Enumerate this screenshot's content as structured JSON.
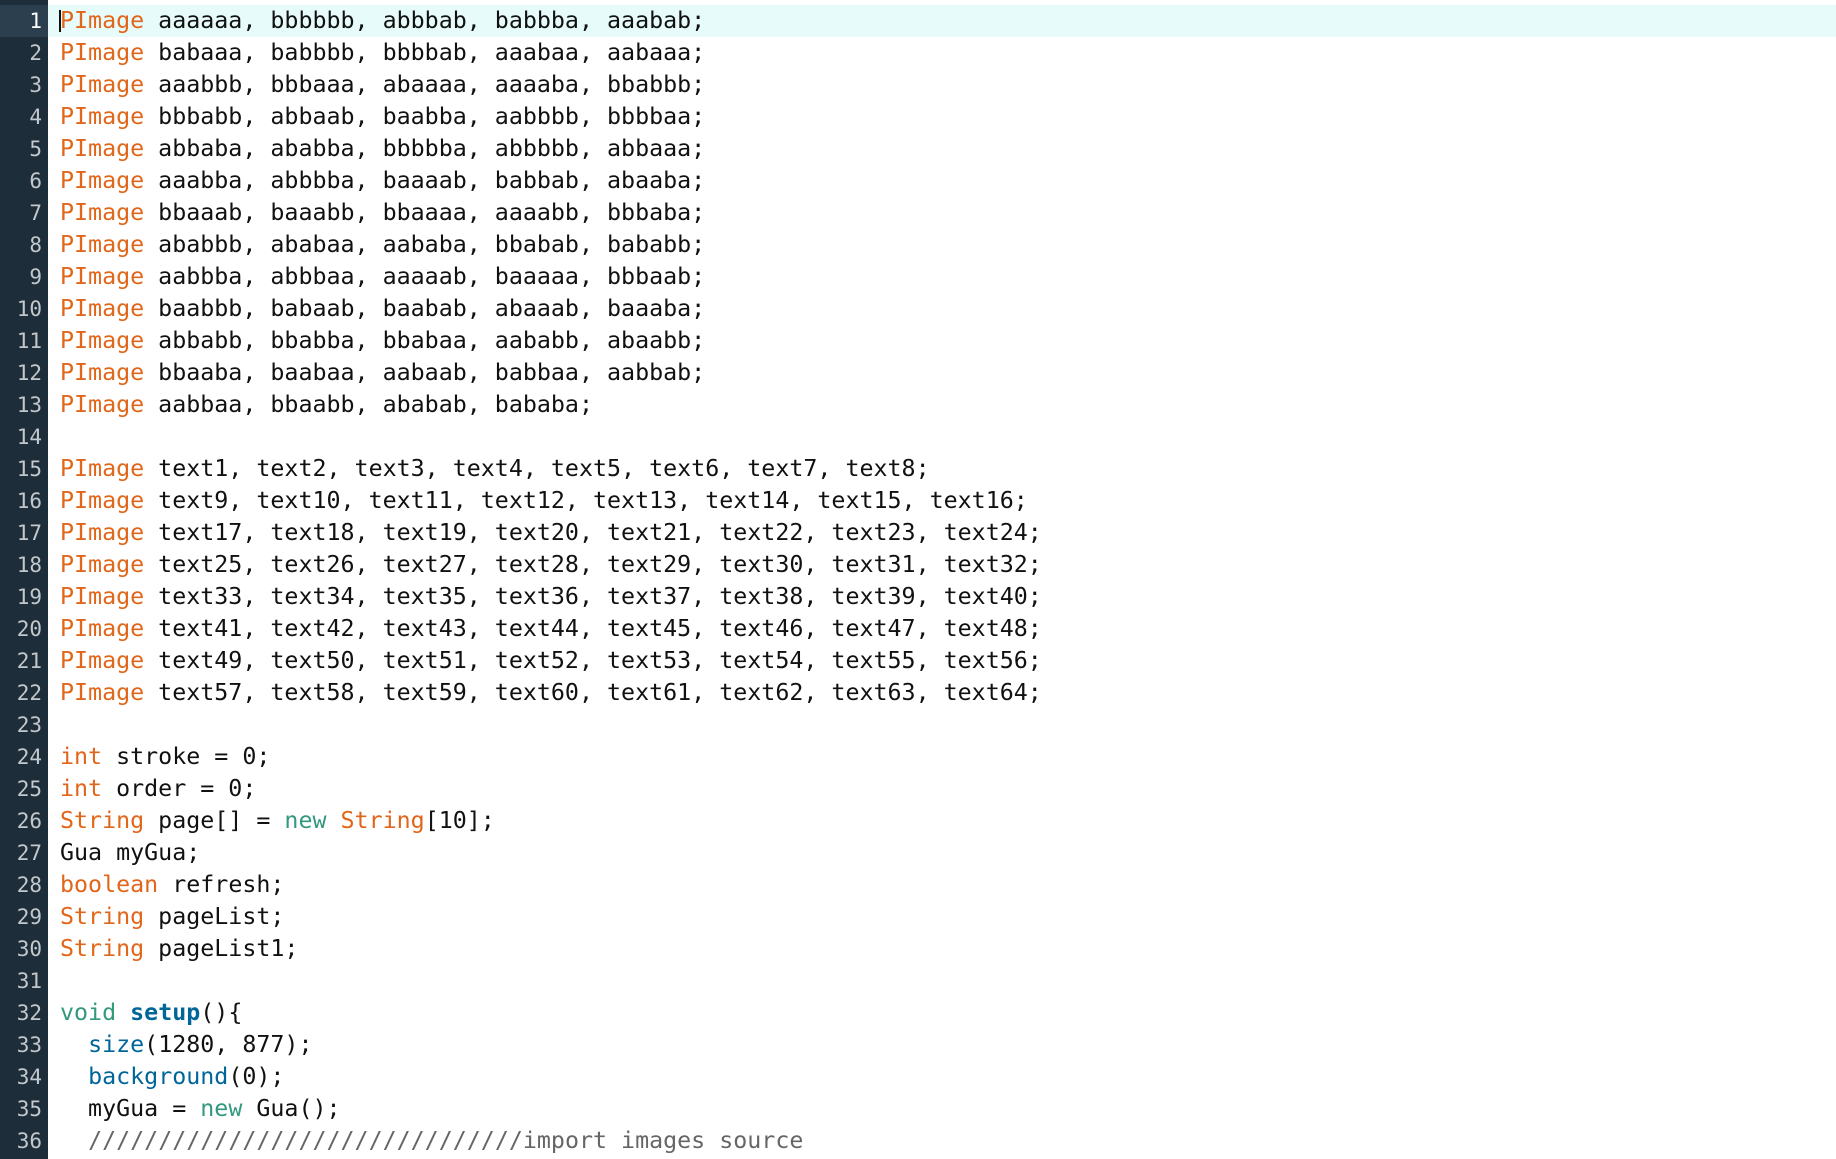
{
  "editor": {
    "current_line": 1,
    "lines": [
      {
        "num": "1",
        "tokens": [
          {
            "t": "type",
            "v": "PImage"
          },
          {
            "t": "plain",
            "v": " aaaaaa, bbbbbb, abbbab, babbba, aaabab;"
          }
        ]
      },
      {
        "num": "2",
        "tokens": [
          {
            "t": "type",
            "v": "PImage"
          },
          {
            "t": "plain",
            "v": " babaaa, babbbb, bbbbab, aaabaa, aabaaa;"
          }
        ]
      },
      {
        "num": "3",
        "tokens": [
          {
            "t": "type",
            "v": "PImage"
          },
          {
            "t": "plain",
            "v": " aaabbb, bbbaaa, abaaaa, aaaaba, bbabbb;"
          }
        ]
      },
      {
        "num": "4",
        "tokens": [
          {
            "t": "type",
            "v": "PImage"
          },
          {
            "t": "plain",
            "v": " bbbabb, abbaab, baabba, aabbbb, bbbbaa;"
          }
        ]
      },
      {
        "num": "5",
        "tokens": [
          {
            "t": "type",
            "v": "PImage"
          },
          {
            "t": "plain",
            "v": " abbaba, ababba, bbbbba, abbbbb, abbaaa;"
          }
        ]
      },
      {
        "num": "6",
        "tokens": [
          {
            "t": "type",
            "v": "PImage"
          },
          {
            "t": "plain",
            "v": " aaabba, abbbba, baaaab, babbab, abaaba;"
          }
        ]
      },
      {
        "num": "7",
        "tokens": [
          {
            "t": "type",
            "v": "PImage"
          },
          {
            "t": "plain",
            "v": " bbaaab, baaabb, bbaaaa, aaaabb, bbbaba;"
          }
        ]
      },
      {
        "num": "8",
        "tokens": [
          {
            "t": "type",
            "v": "PImage"
          },
          {
            "t": "plain",
            "v": " ababbb, ababaa, aababa, bbabab, bababb;"
          }
        ]
      },
      {
        "num": "9",
        "tokens": [
          {
            "t": "type",
            "v": "PImage"
          },
          {
            "t": "plain",
            "v": " aabbba, abbbaa, aaaaab, baaaaa, bbbaab;"
          }
        ]
      },
      {
        "num": "10",
        "tokens": [
          {
            "t": "type",
            "v": "PImage"
          },
          {
            "t": "plain",
            "v": " baabbb, babaab, baabab, abaaab, baaaba;"
          }
        ]
      },
      {
        "num": "11",
        "tokens": [
          {
            "t": "type",
            "v": "PImage"
          },
          {
            "t": "plain",
            "v": " abbabb, bbabba, bbabaa, aababb, abaabb;"
          }
        ]
      },
      {
        "num": "12",
        "tokens": [
          {
            "t": "type",
            "v": "PImage"
          },
          {
            "t": "plain",
            "v": " bbaaba, baabaa, aabaab, babbaa, aabbab;"
          }
        ]
      },
      {
        "num": "13",
        "tokens": [
          {
            "t": "type",
            "v": "PImage"
          },
          {
            "t": "plain",
            "v": " aabbaa, bbaabb, ababab, bababa;"
          }
        ]
      },
      {
        "num": "14",
        "tokens": []
      },
      {
        "num": "15",
        "tokens": [
          {
            "t": "type",
            "v": "PImage"
          },
          {
            "t": "plain",
            "v": " text1, text2, text3, text4, text5, text6, text7, text8;"
          }
        ]
      },
      {
        "num": "16",
        "tokens": [
          {
            "t": "type",
            "v": "PImage"
          },
          {
            "t": "plain",
            "v": " text9, text10, text11, text12, text13, text14, text15, text16;"
          }
        ]
      },
      {
        "num": "17",
        "tokens": [
          {
            "t": "type",
            "v": "PImage"
          },
          {
            "t": "plain",
            "v": " text17, text18, text19, text20, text21, text22, text23, text24;"
          }
        ]
      },
      {
        "num": "18",
        "tokens": [
          {
            "t": "type",
            "v": "PImage"
          },
          {
            "t": "plain",
            "v": " text25, text26, text27, text28, text29, text30, text31, text32;"
          }
        ]
      },
      {
        "num": "19",
        "tokens": [
          {
            "t": "type",
            "v": "PImage"
          },
          {
            "t": "plain",
            "v": " text33, text34, text35, text36, text37, text38, text39, text40;"
          }
        ]
      },
      {
        "num": "20",
        "tokens": [
          {
            "t": "type",
            "v": "PImage"
          },
          {
            "t": "plain",
            "v": " text41, text42, text43, text44, text45, text46, text47, text48;"
          }
        ]
      },
      {
        "num": "21",
        "tokens": [
          {
            "t": "type",
            "v": "PImage"
          },
          {
            "t": "plain",
            "v": " text49, text50, text51, text52, text53, text54, text55, text56;"
          }
        ]
      },
      {
        "num": "22",
        "tokens": [
          {
            "t": "type",
            "v": "PImage"
          },
          {
            "t": "plain",
            "v": " text57, text58, text59, text60, text61, text62, text63, text64;"
          }
        ]
      },
      {
        "num": "23",
        "tokens": []
      },
      {
        "num": "24",
        "tokens": [
          {
            "t": "type",
            "v": "int"
          },
          {
            "t": "plain",
            "v": " stroke = 0;"
          }
        ]
      },
      {
        "num": "25",
        "tokens": [
          {
            "t": "type",
            "v": "int"
          },
          {
            "t": "plain",
            "v": " order = 0;"
          }
        ]
      },
      {
        "num": "26",
        "tokens": [
          {
            "t": "type",
            "v": "String"
          },
          {
            "t": "plain",
            "v": " page[] = "
          },
          {
            "t": "kw",
            "v": "new"
          },
          {
            "t": "plain",
            "v": " "
          },
          {
            "t": "type",
            "v": "String"
          },
          {
            "t": "plain",
            "v": "[10];"
          }
        ]
      },
      {
        "num": "27",
        "tokens": [
          {
            "t": "plain",
            "v": "Gua myGua;"
          }
        ]
      },
      {
        "num": "28",
        "tokens": [
          {
            "t": "type",
            "v": "boolean"
          },
          {
            "t": "plain",
            "v": " refresh;"
          }
        ]
      },
      {
        "num": "29",
        "tokens": [
          {
            "t": "type",
            "v": "String"
          },
          {
            "t": "plain",
            "v": " pageList;"
          }
        ]
      },
      {
        "num": "30",
        "tokens": [
          {
            "t": "type",
            "v": "String"
          },
          {
            "t": "plain",
            "v": " pageList1;"
          }
        ]
      },
      {
        "num": "31",
        "tokens": []
      },
      {
        "num": "32",
        "tokens": [
          {
            "t": "kw",
            "v": "void"
          },
          {
            "t": "plain",
            "v": " "
          },
          {
            "t": "fnb",
            "v": "setup"
          },
          {
            "t": "plain",
            "v": "(){"
          }
        ]
      },
      {
        "num": "33",
        "tokens": [
          {
            "t": "plain",
            "v": "  "
          },
          {
            "t": "fn",
            "v": "size"
          },
          {
            "t": "plain",
            "v": "(1280, 877);"
          }
        ]
      },
      {
        "num": "34",
        "tokens": [
          {
            "t": "plain",
            "v": "  "
          },
          {
            "t": "fn",
            "v": "background"
          },
          {
            "t": "plain",
            "v": "(0);"
          }
        ]
      },
      {
        "num": "35",
        "tokens": [
          {
            "t": "plain",
            "v": "  myGua = "
          },
          {
            "t": "kw",
            "v": "new"
          },
          {
            "t": "plain",
            "v": " Gua();"
          }
        ]
      },
      {
        "num": "36",
        "tokens": [
          {
            "t": "plain",
            "v": "  "
          },
          {
            "t": "com",
            "v": "///////////////////////////////import images source"
          }
        ]
      }
    ]
  },
  "colors": {
    "gutter": "#1d2d3a",
    "current_line": "#e6fbfa",
    "type": "#e2661a",
    "keyword": "#33997e",
    "function": "#006699",
    "comment": "#666666"
  }
}
